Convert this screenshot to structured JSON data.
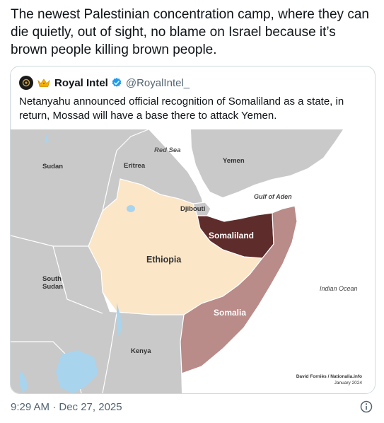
{
  "post": {
    "text": "The newest Palestinian concentration camp, where they can die quietly, out of sight, no blame on Israel because it’s brown people killing brown people.",
    "timestamp": "9:29 AM · Dec 27, 2025"
  },
  "quote": {
    "author_name": "Royal Intel",
    "handle": "@RoyalIntel_",
    "text": "Netanyahu announced official recognition of Somaliland as a state, in return, Mossad will have a base there to attack Yemen."
  },
  "map": {
    "labels": {
      "red_sea": "Red Sea",
      "yemen": "Yemen",
      "sudan": "Sudan",
      "eritrea": "Eritrea",
      "gulf_of_aden": "Gulf of Aden",
      "djibouti": "Djibouti",
      "somaliland": "Somaliland",
      "ethiopia": "Ethiopia",
      "south_sudan_1": "South",
      "south_sudan_2": "Sudan",
      "indian_ocean": "Indian Ocean",
      "somalia": "Somalia",
      "kenya": "Kenya"
    },
    "credit": {
      "line1": "David Forniès / Nationalia.info",
      "line2": "January 2024"
    },
    "colors": {
      "sea": "#ffffff",
      "land": "#c9c9c9",
      "ethiopia": "#fbe6c8",
      "somaliland": "#5e2d2b",
      "somalia": "#b98b89",
      "water": "#a8d4ee",
      "border": "#ffffff"
    }
  },
  "icons": {
    "crown": "crown-icon",
    "verified": "verified-badge-icon",
    "info": "info-icon"
  }
}
